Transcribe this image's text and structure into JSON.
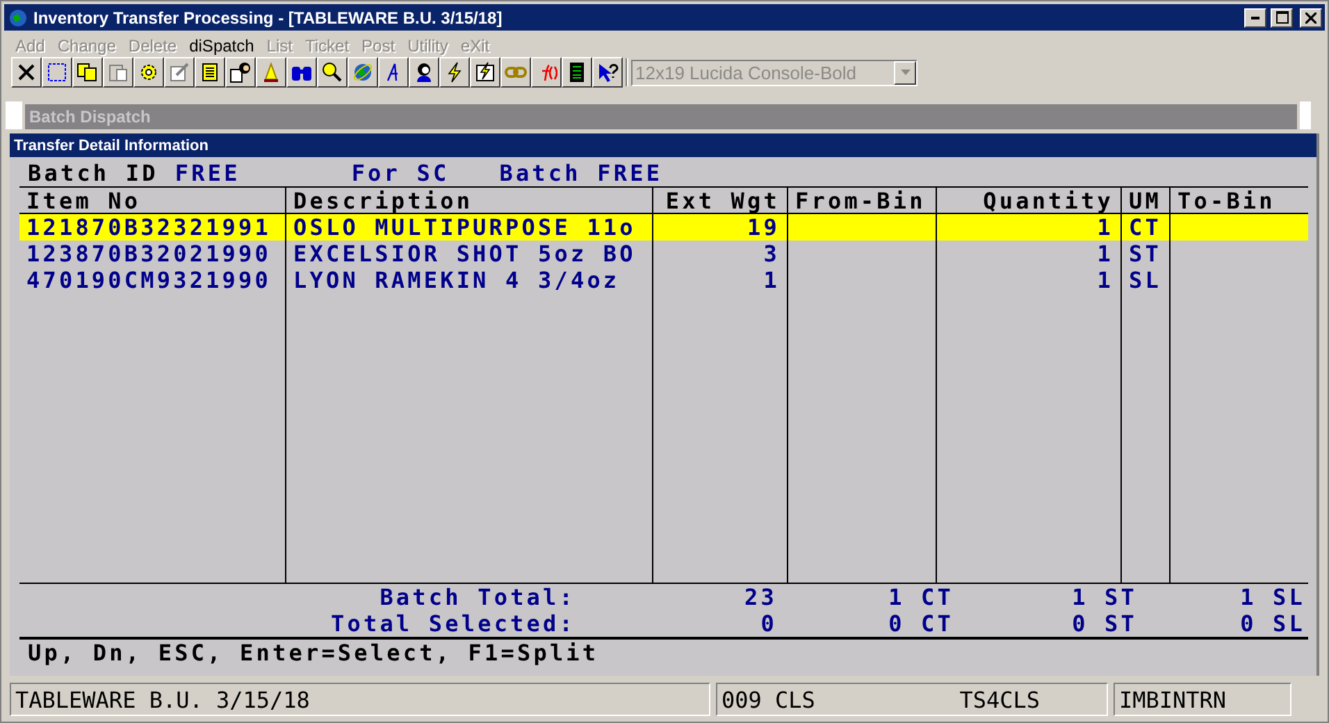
{
  "window": {
    "title": "Inventory Transfer Processing - [TABLEWARE B.U. 3/15/18]"
  },
  "menu": [
    {
      "label": "Add",
      "disabled": true
    },
    {
      "label": "Change",
      "disabled": true
    },
    {
      "label": "Delete",
      "disabled": true
    },
    {
      "label": "diSpatch",
      "disabled": false
    },
    {
      "label": "List",
      "disabled": true
    },
    {
      "label": "Ticket",
      "disabled": true
    },
    {
      "label": "Post",
      "disabled": true
    },
    {
      "label": "Utility",
      "disabled": true
    },
    {
      "label": "eXit",
      "disabled": true
    }
  ],
  "toolbar": {
    "font_select": {
      "value": "12x19 Lucida Console-Bold",
      "disabled": true
    }
  },
  "tab_strip": {
    "label": "Batch Dispatch"
  },
  "panel": {
    "title": "Transfer Detail Information",
    "header": [
      {
        "kind": "label",
        "text": "Batch ID"
      },
      {
        "kind": "value",
        "text": "FREE"
      },
      {
        "kind": "value",
        "text": "For SC"
      },
      {
        "kind": "value",
        "text": "Batch FREE"
      }
    ],
    "table": {
      "columns": [
        {
          "label": "Item No"
        },
        {
          "label": "Description"
        },
        {
          "label": "Ext Wgt"
        },
        {
          "label": "From-Bin"
        },
        {
          "label": "Quantity"
        },
        {
          "label": "UM"
        },
        {
          "label": "To-Bin"
        }
      ],
      "rows": [
        {
          "selected": true,
          "cells": [
            "121870B32321991",
            "OSLO MULTIPURPOSE 11o",
            "19",
            "",
            "1",
            "CT",
            ""
          ]
        },
        {
          "selected": false,
          "cells": [
            "123870B32021990",
            "EXCELSIOR SHOT 5oz BO",
            "3",
            "",
            "1",
            "ST",
            ""
          ]
        },
        {
          "selected": false,
          "cells": [
            "470190CM9321990",
            "LYON RAMEKIN 4 3/4oz",
            "1",
            "",
            "1",
            "SL",
            ""
          ]
        }
      ]
    },
    "totals": [
      {
        "label": "Batch Total:",
        "ext_wgt": "23",
        "qty": [
          {
            "value": "1",
            "um": "CT"
          },
          {
            "value": "1",
            "um": "ST"
          },
          {
            "value": "1",
            "um": "SL"
          }
        ]
      },
      {
        "label": "Total Selected:",
        "ext_wgt": "0",
        "qty": [
          {
            "value": "0",
            "um": "CT"
          },
          {
            "value": "0",
            "um": "ST"
          },
          {
            "value": "0",
            "um": "SL"
          }
        ]
      }
    ],
    "help": "Up, Dn, ESC, Enter=Select, F1=Split"
  },
  "status_bar": [
    {
      "texts": [
        "TABLEWARE B.U. 3/15/18"
      ]
    },
    {
      "texts": [
        "009 CLS",
        "TS4CLS"
      ]
    },
    {
      "texts": [
        "IMBINTRN"
      ]
    }
  ]
}
